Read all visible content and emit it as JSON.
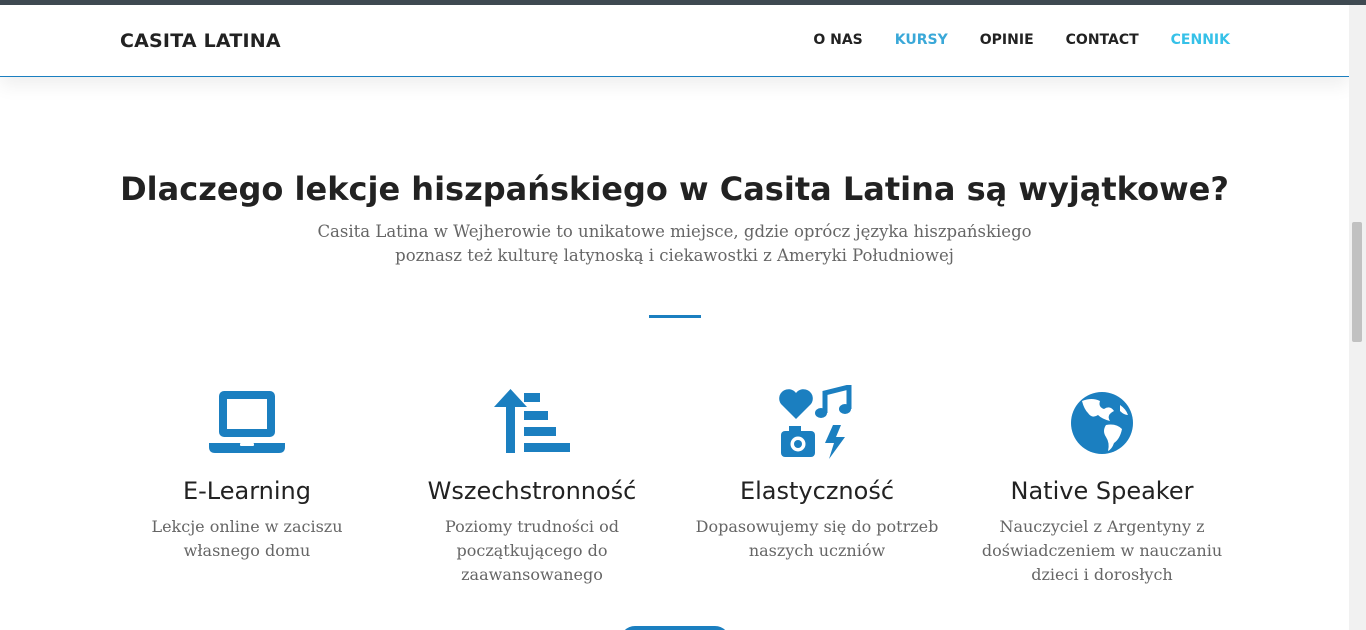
{
  "nav": {
    "brand": "CASITA LATINA",
    "items": [
      {
        "label": "O NAS"
      },
      {
        "label": "KURSY"
      },
      {
        "label": "OPINIE"
      },
      {
        "label": "CONTACT"
      },
      {
        "label": "CENNIK"
      }
    ]
  },
  "section": {
    "heading": "Dlaczego lekcje hiszpańskiego w Casita Latina są wyjątkowe?",
    "subtitle_lines": [
      "Casita Latina w Wejherowie to unikatowe miejsce, gdzie oprócz języka hiszpańskiego",
      "poznasz też kulturę latynoską i ciekawostki z Ameryki Południowej"
    ]
  },
  "features": [
    {
      "icon": "laptop-icon",
      "title": "E-Learning",
      "desc_lines": [
        "Lekcje online w zaciszu",
        "własnego domu"
      ]
    },
    {
      "icon": "sort-amount-up-icon",
      "title": "Wszechstronność",
      "desc_lines": [
        "Poziomy trudności od",
        "początkującego do",
        "zaawansowanego"
      ]
    },
    {
      "icon": "icons-heart-music-camera-bolt-icon",
      "title": "Elastyczność",
      "desc_lines": [
        "Dopasowujemy się do potrzeb",
        "naszych uczniów"
      ]
    },
    {
      "icon": "globe-americas-icon",
      "title": "Native Speaker",
      "desc_lines": [
        "Nauczyciel z Argentyny z",
        "doświadczeniem w nauczaniu",
        "dzieci i dorosłych"
      ]
    }
  ],
  "colors": {
    "accent": "#1b7fc0",
    "nav_active": "#3aa8d8",
    "nav_cennik": "#36c1e8",
    "text_dark": "#222222",
    "text_muted": "#666666"
  }
}
